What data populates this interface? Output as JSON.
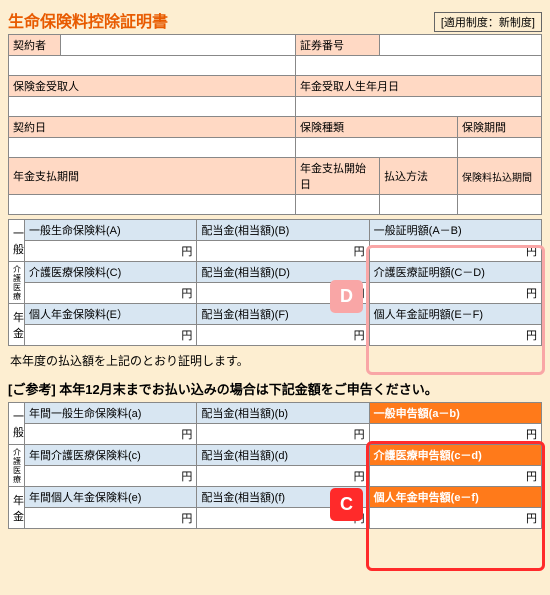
{
  "header": {
    "title": "生命保険料控除証明書",
    "system": "[適用制度：新制度]"
  },
  "top": {
    "contractor_label": "契約者",
    "policy_no_label": "証券番号",
    "beneficiary_label": "保険金受取人",
    "annuitant_dob_label": "年金受取人生年月日",
    "contract_date_label": "契約日",
    "ins_type_label": "保険種類",
    "ins_period_label": "保険期間",
    "pension_pay_period_label": "年金支払期間",
    "pension_start_date_label": "年金支払開始日",
    "pay_method_label": "払込方法",
    "premium_pay_period_label": "保険料払込期間"
  },
  "mid": {
    "rowlabels": {
      "general": "一般",
      "care": "介護医療",
      "pension": "年金"
    },
    "A": "一般生命保険料(A)",
    "B": "配当金(相当額)(B)",
    "AB": "一般証明額(A－B)",
    "C": "介護医療保険料(C)",
    "D": "配当金(相当額)(D)",
    "CD": "介護医療証明額(C－D)",
    "E": "個人年金保険料(E）",
    "F": "配当金(相当額)(F)",
    "EF": "個人年金証明額(E－F)",
    "yen": "円"
  },
  "cert_text": "本年度の払込額を上記のとおり証明します。",
  "ref_text": "[ご参考] 本年12月末までお払い込みの場合は下記金額をご申告ください。",
  "bot": {
    "a": "年間一般生命保険料(a)",
    "b": "配当金(相当額)(b)",
    "ab": "一般申告額(a－b)",
    "c": "年間介護医療保険料(c)",
    "d": "配当金(相当額)(d)",
    "cd": "介護医療申告額(c－d)",
    "e": "年間個人年金保険料(e)",
    "f": "配当金(相当額)(f)",
    "ef": "個人年金申告額(e－f)"
  },
  "badges": {
    "D": "D",
    "C": "C"
  }
}
